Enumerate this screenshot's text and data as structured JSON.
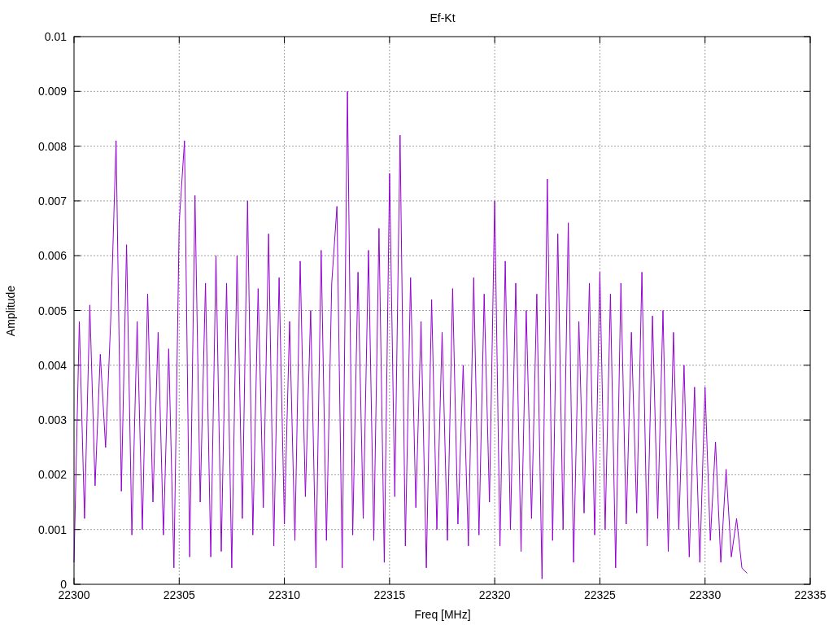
{
  "chart": {
    "chart_data": {
      "type": "line",
      "title": "Ef-Kt",
      "xlabel": "Freq [MHz]",
      "ylabel": "Amplitude",
      "grid": true,
      "xlim": [
        22300,
        22335
      ],
      "ylim": [
        0,
        0.01
      ],
      "xticks": [
        22300,
        22305,
        22310,
        22315,
        22320,
        22325,
        22330,
        22335
      ],
      "yticks": [
        0.01,
        0.009,
        0.008,
        0.007,
        0.006,
        0.005,
        0.004,
        0.003,
        0.002,
        0.001,
        0
      ],
      "x": [
        22300,
        22300.25,
        22300.5,
        22300.75,
        22301,
        22301.25,
        22301.5,
        22301.75,
        22302,
        22302.25,
        22302.5,
        22302.75,
        22303,
        22303.25,
        22303.5,
        22303.75,
        22304,
        22304.25,
        22304.5,
        22304.75,
        22305,
        22305.25,
        22305.5,
        22305.75,
        22306,
        22306.25,
        22306.5,
        22306.75,
        22307,
        22307.25,
        22307.5,
        22307.75,
        22308,
        22308.25,
        22308.5,
        22308.75,
        22309,
        22309.25,
        22309.5,
        22309.75,
        22310,
        22310.25,
        22310.5,
        22310.75,
        22311,
        22311.25,
        22311.5,
        22311.75,
        22312,
        22312.25,
        22312.5,
        22312.75,
        22313,
        22313.25,
        22313.5,
        22313.75,
        22314,
        22314.25,
        22314.5,
        22314.75,
        22315,
        22315.25,
        22315.5,
        22315.75,
        22316,
        22316.25,
        22316.5,
        22316.75,
        22317,
        22317.25,
        22317.5,
        22317.75,
        22318,
        22318.25,
        22318.5,
        22318.75,
        22319,
        22319.25,
        22319.5,
        22319.75,
        22320,
        22320.25,
        22320.5,
        22320.75,
        22321,
        22321.25,
        22321.5,
        22321.75,
        22322,
        22322.25,
        22322.5,
        22322.75,
        22323,
        22323.25,
        22323.5,
        22323.75,
        22324,
        22324.25,
        22324.5,
        22324.75,
        22325,
        22325.25,
        22325.5,
        22325.75,
        22326,
        22326.25,
        22326.5,
        22326.75,
        22327,
        22327.25,
        22327.5,
        22327.75,
        22328,
        22328.25,
        22328.5,
        22328.75,
        22329,
        22329.25,
        22329.5,
        22329.75,
        22330,
        22330.25,
        22330.5,
        22330.75,
        22331,
        22331.25,
        22331.5,
        22331.75,
        22332
      ],
      "series": [
        {
          "color": "#9400d3",
          "values": [
            0.0004,
            0.0048,
            0.0012,
            0.0051,
            0.0018,
            0.0042,
            0.0025,
            0.0049,
            0.0081,
            0.0017,
            0.0062,
            0.0009,
            0.0048,
            0.001,
            0.0053,
            0.0015,
            0.0046,
            0.0009,
            0.0043,
            0.0003,
            0.0066,
            0.0081,
            0.0005,
            0.0071,
            0.0015,
            0.0055,
            0.0005,
            0.006,
            0.0006,
            0.0055,
            0.0003,
            0.006,
            0.0012,
            0.007,
            0.0009,
            0.0054,
            0.0014,
            0.0064,
            0.0007,
            0.0056,
            0.0011,
            0.0048,
            0.0008,
            0.0059,
            0.0016,
            0.005,
            0.0003,
            0.0061,
            0.0008,
            0.0055,
            0.0069,
            0.0003,
            0.009,
            0.0009,
            0.0057,
            0.0012,
            0.0061,
            0.0008,
            0.0065,
            0.0004,
            0.0075,
            0.0016,
            0.0082,
            0.0007,
            0.0056,
            0.0014,
            0.0048,
            0.0003,
            0.0052,
            0.001,
            0.0046,
            0.0008,
            0.0054,
            0.0011,
            0.004,
            0.0007,
            0.0056,
            0.0009,
            0.0053,
            0.0015,
            0.007,
            0.0007,
            0.0059,
            0.001,
            0.0055,
            0.0006,
            0.005,
            0.0012,
            0.0053,
            0.0001,
            0.0074,
            0.0008,
            0.0064,
            0.001,
            0.0066,
            0.0004,
            0.0048,
            0.0013,
            0.0055,
            0.0009,
            0.0057,
            0.001,
            0.0053,
            0.0003,
            0.0055,
            0.0011,
            0.0046,
            0.0013,
            0.0057,
            0.0007,
            0.0049,
            0.0012,
            0.005,
            0.0006,
            0.0046,
            0.001,
            0.004,
            0.0005,
            0.0036,
            0.0004,
            0.0036,
            0.0008,
            0.0026,
            0.0004,
            0.0021,
            0.0005,
            0.0012,
            0.0003,
            0.0002
          ]
        }
      ]
    }
  }
}
